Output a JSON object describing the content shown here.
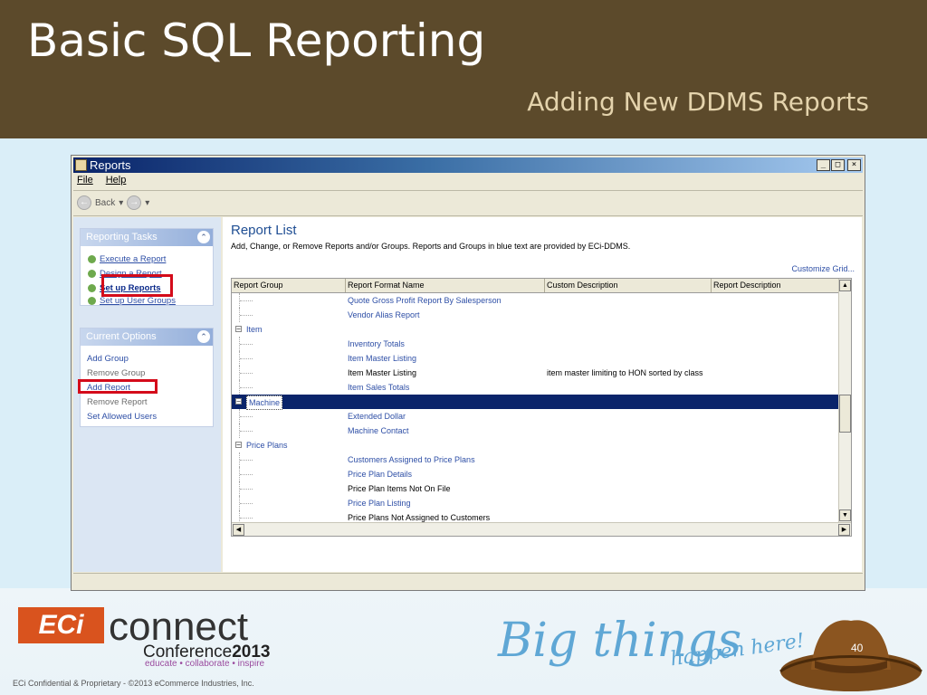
{
  "slide": {
    "title": "Basic SQL Reporting",
    "subtitle": "Adding New DDMS Reports",
    "footer": "ECi Confidential & Proprietary - ©2013 eCommerce Industries, Inc.",
    "page_number": "40"
  },
  "logos": {
    "eci": "ECi",
    "connect": "connect",
    "conference": "Conference",
    "conference_year": "2013",
    "tagline": "educate • collaborate • inspire",
    "big_things": "Big things",
    "happen_here": "happen here!"
  },
  "window": {
    "title": "Reports",
    "controls": {
      "minimize": "_",
      "maximize": "□",
      "close": "×"
    },
    "menu": [
      "File",
      "Help"
    ],
    "toolbar": {
      "back": "Back"
    }
  },
  "left_pane": {
    "tasks_header": "Reporting Tasks",
    "tasks": [
      "Execute a Report",
      "Design a Report",
      "Set up Reports",
      "Set up User Groups"
    ],
    "options_header": "Current Options",
    "options": [
      {
        "label": "Add Group",
        "enabled": true
      },
      {
        "label": "Remove Group",
        "enabled": false
      },
      {
        "label": "Add Report",
        "enabled": true
      },
      {
        "label": "Remove Report",
        "enabled": false
      },
      {
        "label": "Set Allowed Users",
        "enabled": true
      }
    ]
  },
  "report_list": {
    "title": "Report List",
    "description": "Add, Change, or Remove Reports and/or Groups.  Reports and Groups in blue text are provided by ECi-DDMS.",
    "customize": "Customize Grid...",
    "columns": [
      "Report Group",
      "Report Format Name",
      "Custom Description",
      "Report Description"
    ],
    "rows": [
      {
        "group": "",
        "name": "Quote Gross Profit Report By Salesperson",
        "custom": "",
        "desc": "",
        "blue": true
      },
      {
        "group": "",
        "name": "Vendor Alias Report",
        "custom": "",
        "desc": "",
        "blue": true
      },
      {
        "group": "Item",
        "name": "",
        "custom": "",
        "desc": "",
        "blue": true
      },
      {
        "group": "",
        "name": "Inventory Totals",
        "custom": "",
        "desc": "",
        "blue": true
      },
      {
        "group": "",
        "name": "Item Master Listing",
        "custom": "",
        "desc": "",
        "blue": true
      },
      {
        "group": "",
        "name": "Item Master Listing",
        "custom": "item master limiting to HON sorted by class",
        "desc": "",
        "blue": false
      },
      {
        "group": "",
        "name": "Item Sales Totals",
        "custom": "",
        "desc": "",
        "blue": true
      },
      {
        "group": "Machine",
        "name": "",
        "custom": "",
        "desc": "",
        "blue": true,
        "selected": true
      },
      {
        "group": "",
        "name": "Extended Dollar",
        "custom": "",
        "desc": "",
        "blue": true
      },
      {
        "group": "",
        "name": "Machine Contact",
        "custom": "",
        "desc": "",
        "blue": true
      },
      {
        "group": "Price Plans",
        "name": "",
        "custom": "",
        "desc": "",
        "blue": true
      },
      {
        "group": "",
        "name": "Customers Assigned to Price Plans",
        "custom": "",
        "desc": "",
        "blue": true
      },
      {
        "group": "",
        "name": "Price Plan Details",
        "custom": "",
        "desc": "",
        "blue": true
      },
      {
        "group": "",
        "name": "Price Plan Items Not On File",
        "custom": "",
        "desc": "",
        "blue": false
      },
      {
        "group": "",
        "name": "Price Plan Listing",
        "custom": "",
        "desc": "",
        "blue": true
      },
      {
        "group": "",
        "name": "Price Plans Not Assigned to Customers",
        "custom": "",
        "desc": "",
        "blue": false
      }
    ]
  },
  "colors": {
    "banner": "#5c4a2b",
    "subtitle": "#e4d3ac",
    "highlight": "#d40b1a",
    "selected_row": "#0a246a",
    "link_blue": "#2e4fa6"
  }
}
